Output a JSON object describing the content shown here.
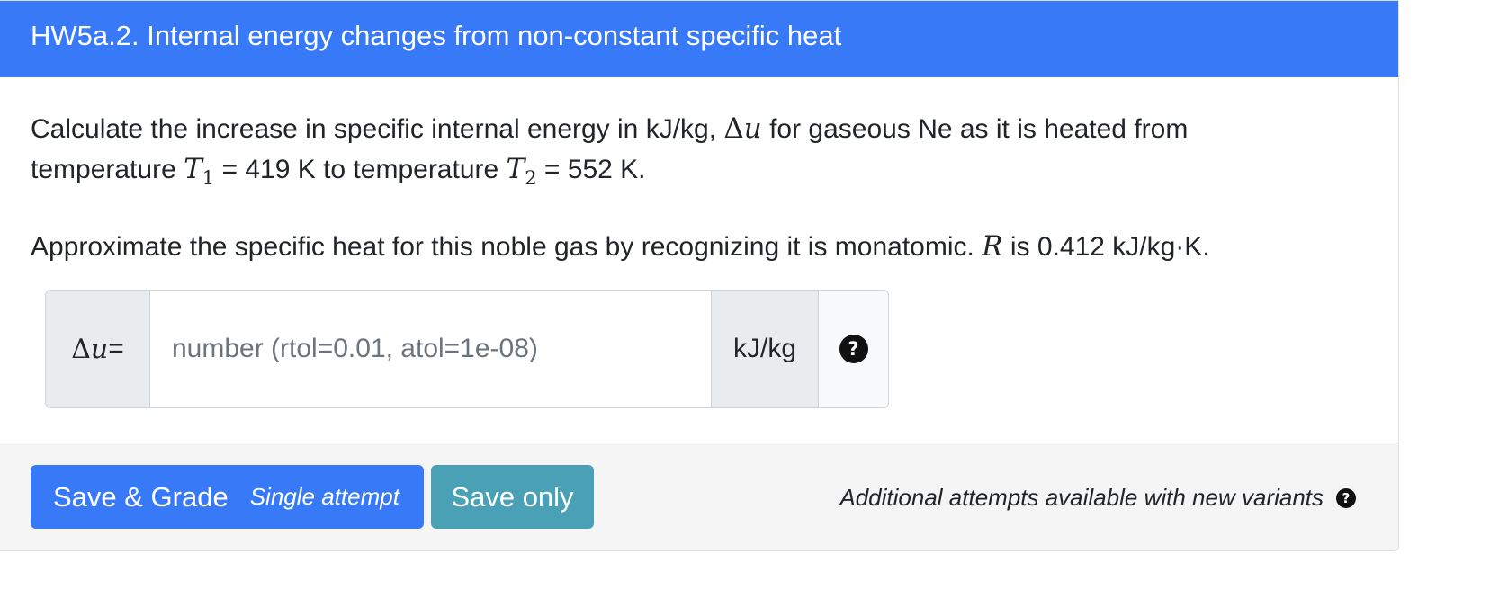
{
  "header": {
    "title": "HW5a.2. Internal energy changes from non-constant specific heat"
  },
  "question": {
    "line1_text_a": "Calculate the increase in specific internal energy in kJ/kg, ",
    "line1_math_delta": "Δ",
    "line1_math_u": "u",
    "line1_text_b": " for gaseous Ne as it is heated from",
    "line2_text_a": "temperature ",
    "t1_symbol": "T",
    "t1_subscript": "1",
    "line2_text_b": " = 419 K to temperature ",
    "t2_symbol": "T",
    "t2_subscript": "2",
    "line2_text_c": " = 552 K.",
    "para2_text_a": "Approximate the specific heat for this noble gas by recognizing it is monatomic. ",
    "r_symbol": "R",
    "para2_text_b": " is 0.412 kJ/kg·K."
  },
  "answer_input": {
    "label_delta": "Δ",
    "label_u": "u",
    "label_eq": "=",
    "value": "",
    "placeholder": "number (rtol=0.01, atol=1e-08)",
    "unit": "kJ/kg",
    "help_icon": "?"
  },
  "footer": {
    "grade_button_label": "Save & Grade",
    "grade_button_sub": "Single attempt",
    "save_only_label": "Save only",
    "attempts_text": "Additional attempts available with new variants",
    "attempts_help_icon": "?"
  },
  "colors": {
    "header_bg": "#3779f6",
    "grade_button_bg": "#3779f6",
    "save_only_bg": "#4aa1b6",
    "footer_bg": "#f5f5f5",
    "input_addon_bg": "#e9ecef"
  },
  "icons": {
    "input_help": "question-circle-icon",
    "attempts_help": "question-circle-icon"
  }
}
